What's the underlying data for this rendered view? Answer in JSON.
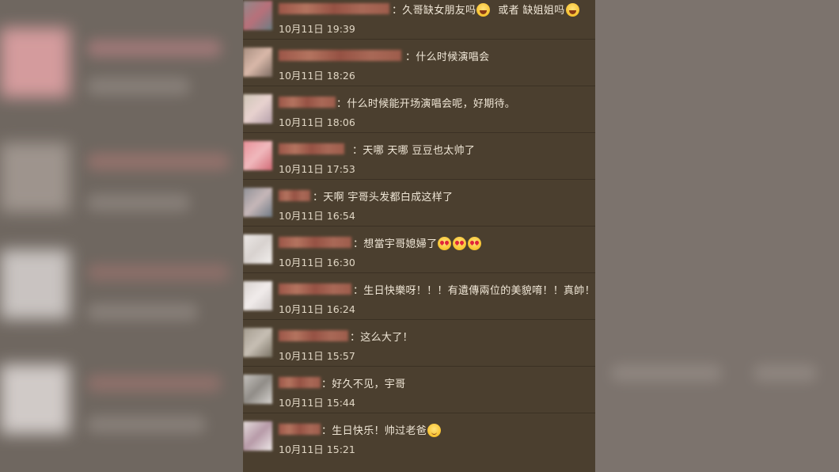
{
  "comments": [
    {
      "text": "：久哥缺女朋友吗",
      "emoji_mid": "laugh-icon",
      "text2": "或者 缺姐姐吗",
      "emoji_end": "laugh-icon",
      "time": "10月11日 19:39"
    },
    {
      "text": "：什么时候演唱会",
      "time": "10月11日 18:26"
    },
    {
      "text": "：什么时候能开场演唱会呢，好期待。",
      "time": "10月11日 18:06"
    },
    {
      "text": "：天哪 天哪 豆豆也太帅了",
      "time": "10月11日 17:53"
    },
    {
      "text": "：天啊 宇哥头发都白成这样了",
      "time": "10月11日 16:54"
    },
    {
      "text": "：想當宇哥媳婦了",
      "emoji_end": "heart-eyes-icon",
      "emoji_count": 3,
      "time": "10月11日 16:30"
    },
    {
      "text": "：生日快樂呀！！！有遺傳兩位的美貌唷！！真帥！",
      "time": "10月11日 16:24"
    },
    {
      "text": "：这么大了！",
      "time": "10月11日 15:57"
    },
    {
      "text": "：好久不见，宇哥",
      "time": "10月11日 15:44"
    },
    {
      "text": "：生日快乐！帅过老爸",
      "emoji_end": "smile-icon",
      "time": "10月11日 15:21"
    }
  ],
  "colors": {
    "panel": "#4b3f2f",
    "text": "#efe6d6",
    "divider": "#3b3124",
    "backdrop": "#7a716b"
  }
}
